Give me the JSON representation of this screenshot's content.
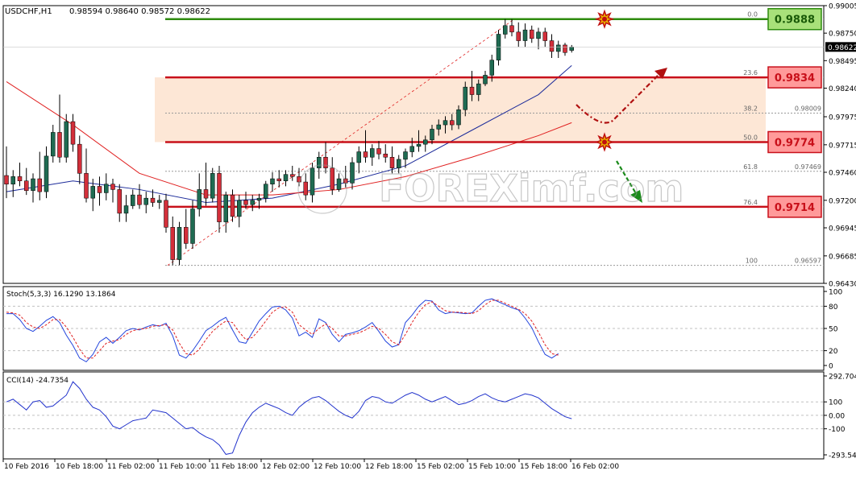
{
  "header": {
    "symbol_label": "USDCHF,H1",
    "ohlc_text": "0.98594 0.98640 0.98572 0.98622"
  },
  "watermark": "FOREXimf.com",
  "colors": {
    "bull": "#1f6b52",
    "bear": "#d32f3a",
    "level_green": "#2e8b0f",
    "level_red": "#c8101a",
    "ma_blue": "#1c2b9a",
    "ma_red": "#e02020",
    "zone": "#fde7d6",
    "stoch_main": "#2244dd",
    "stoch_signal": "#e02020",
    "cci_line": "#2233cc",
    "grid": "#c0c0c0",
    "frame": "#000000"
  },
  "chart_data": [
    {
      "type": "candlestick",
      "symbol": "USDCHF",
      "timeframe": "H1",
      "price_axis": {
        "ticks": [
          "0.99005",
          "0.98750",
          "0.98495",
          "0.98240",
          "0.97975",
          "0.97715",
          "0.97460",
          "0.97200",
          "0.96945",
          "0.96685",
          "0.96430"
        ],
        "ylim": [
          0.9643,
          0.99005
        ],
        "current_price_label": "0.98622"
      },
      "time_axis": {
        "labels": [
          "10 Feb 2016",
          "10 Feb 18:00",
          "11 Feb 02:00",
          "11 Feb 10:00",
          "11 Feb 18:00",
          "12 Feb 02:00",
          "12 Feb 10:00",
          "12 Feb 18:00",
          "15 Feb 02:00",
          "15 Feb 10:00",
          "15 Feb 18:00",
          "16 Feb 02:00"
        ]
      },
      "candles": [
        {
          "o": 0.9743,
          "h": 0.977,
          "l": 0.9722,
          "c": 0.9735
        },
        {
          "o": 0.9735,
          "h": 0.9748,
          "l": 0.9723,
          "c": 0.9742
        },
        {
          "o": 0.9742,
          "h": 0.9755,
          "l": 0.9733,
          "c": 0.9738
        },
        {
          "o": 0.9738,
          "h": 0.975,
          "l": 0.9725,
          "c": 0.9729
        },
        {
          "o": 0.9729,
          "h": 0.9745,
          "l": 0.9718,
          "c": 0.974
        },
        {
          "o": 0.974,
          "h": 0.9765,
          "l": 0.972,
          "c": 0.9728
        },
        {
          "o": 0.9728,
          "h": 0.977,
          "l": 0.9722,
          "c": 0.9761
        },
        {
          "o": 0.9761,
          "h": 0.979,
          "l": 0.9755,
          "c": 0.9783
        },
        {
          "o": 0.9783,
          "h": 0.9818,
          "l": 0.9755,
          "c": 0.976
        },
        {
          "o": 0.976,
          "h": 0.98,
          "l": 0.9755,
          "c": 0.9793
        },
        {
          "o": 0.9793,
          "h": 0.98,
          "l": 0.9765,
          "c": 0.9772
        },
        {
          "o": 0.9772,
          "h": 0.978,
          "l": 0.9735,
          "c": 0.9745
        },
        {
          "o": 0.9745,
          "h": 0.9768,
          "l": 0.9718,
          "c": 0.9722
        },
        {
          "o": 0.9722,
          "h": 0.974,
          "l": 0.971,
          "c": 0.9733
        },
        {
          "o": 0.9733,
          "h": 0.9742,
          "l": 0.9715,
          "c": 0.9727
        },
        {
          "o": 0.9727,
          "h": 0.9745,
          "l": 0.972,
          "c": 0.9735
        },
        {
          "o": 0.9735,
          "h": 0.974,
          "l": 0.9718,
          "c": 0.973
        },
        {
          "o": 0.973,
          "h": 0.9735,
          "l": 0.97,
          "c": 0.9708
        },
        {
          "o": 0.9708,
          "h": 0.9725,
          "l": 0.97,
          "c": 0.9715
        },
        {
          "o": 0.9715,
          "h": 0.973,
          "l": 0.9712,
          "c": 0.9725
        },
        {
          "o": 0.9725,
          "h": 0.9735,
          "l": 0.9712,
          "c": 0.9716
        },
        {
          "o": 0.9716,
          "h": 0.9728,
          "l": 0.9708,
          "c": 0.9722
        },
        {
          "o": 0.9722,
          "h": 0.973,
          "l": 0.9714,
          "c": 0.9718
        },
        {
          "o": 0.9718,
          "h": 0.9725,
          "l": 0.9712,
          "c": 0.972
        },
        {
          "o": 0.972,
          "h": 0.9726,
          "l": 0.969,
          "c": 0.9695
        },
        {
          "o": 0.9695,
          "h": 0.9705,
          "l": 0.966,
          "c": 0.9665
        },
        {
          "o": 0.9665,
          "h": 0.97,
          "l": 0.966,
          "c": 0.9695
        },
        {
          "o": 0.9695,
          "h": 0.9712,
          "l": 0.9675,
          "c": 0.968
        },
        {
          "o": 0.968,
          "h": 0.972,
          "l": 0.9675,
          "c": 0.9712
        },
        {
          "o": 0.9712,
          "h": 0.9745,
          "l": 0.9705,
          "c": 0.973
        },
        {
          "o": 0.973,
          "h": 0.9755,
          "l": 0.9715,
          "c": 0.9722
        },
        {
          "o": 0.9722,
          "h": 0.975,
          "l": 0.9718,
          "c": 0.9745
        },
        {
          "o": 0.9745,
          "h": 0.9752,
          "l": 0.969,
          "c": 0.97
        },
        {
          "o": 0.97,
          "h": 0.9728,
          "l": 0.969,
          "c": 0.9725
        },
        {
          "o": 0.9725,
          "h": 0.973,
          "l": 0.97,
          "c": 0.9705
        },
        {
          "o": 0.9705,
          "h": 0.9725,
          "l": 0.9695,
          "c": 0.972
        },
        {
          "o": 0.972,
          "h": 0.9728,
          "l": 0.9712,
          "c": 0.9716
        },
        {
          "o": 0.9716,
          "h": 0.9725,
          "l": 0.971,
          "c": 0.972
        },
        {
          "o": 0.972,
          "h": 0.9726,
          "l": 0.9712,
          "c": 0.9722
        },
        {
          "o": 0.9722,
          "h": 0.9738,
          "l": 0.9718,
          "c": 0.9735
        },
        {
          "o": 0.9735,
          "h": 0.9746,
          "l": 0.9728,
          "c": 0.974
        },
        {
          "o": 0.974,
          "h": 0.9748,
          "l": 0.9732,
          "c": 0.9738
        },
        {
          "o": 0.9738,
          "h": 0.9748,
          "l": 0.9733,
          "c": 0.9744
        },
        {
          "o": 0.9744,
          "h": 0.9752,
          "l": 0.9738,
          "c": 0.9742
        },
        {
          "o": 0.9742,
          "h": 0.975,
          "l": 0.9733,
          "c": 0.9737
        },
        {
          "o": 0.9737,
          "h": 0.9745,
          "l": 0.972,
          "c": 0.9725
        },
        {
          "o": 0.9725,
          "h": 0.9755,
          "l": 0.9718,
          "c": 0.975
        },
        {
          "o": 0.975,
          "h": 0.9765,
          "l": 0.974,
          "c": 0.976
        },
        {
          "o": 0.976,
          "h": 0.9774,
          "l": 0.9745,
          "c": 0.975
        },
        {
          "o": 0.975,
          "h": 0.976,
          "l": 0.9725,
          "c": 0.973
        },
        {
          "o": 0.973,
          "h": 0.9745,
          "l": 0.9728,
          "c": 0.974
        },
        {
          "o": 0.974,
          "h": 0.9752,
          "l": 0.9732,
          "c": 0.9736
        },
        {
          "o": 0.9736,
          "h": 0.976,
          "l": 0.973,
          "c": 0.9755
        },
        {
          "o": 0.9755,
          "h": 0.977,
          "l": 0.9745,
          "c": 0.9765
        },
        {
          "o": 0.9765,
          "h": 0.9785,
          "l": 0.9755,
          "c": 0.976
        },
        {
          "o": 0.976,
          "h": 0.9772,
          "l": 0.9752,
          "c": 0.9768
        },
        {
          "o": 0.9768,
          "h": 0.9775,
          "l": 0.9758,
          "c": 0.9763
        },
        {
          "o": 0.9763,
          "h": 0.9772,
          "l": 0.9755,
          "c": 0.976
        },
        {
          "o": 0.976,
          "h": 0.977,
          "l": 0.9745,
          "c": 0.975
        },
        {
          "o": 0.975,
          "h": 0.9762,
          "l": 0.9745,
          "c": 0.9758
        },
        {
          "o": 0.9758,
          "h": 0.9768,
          "l": 0.975,
          "c": 0.9765
        },
        {
          "o": 0.9765,
          "h": 0.9778,
          "l": 0.976,
          "c": 0.977
        },
        {
          "o": 0.977,
          "h": 0.9785,
          "l": 0.9765,
          "c": 0.9772
        },
        {
          "o": 0.9772,
          "h": 0.978,
          "l": 0.9765,
          "c": 0.9776
        },
        {
          "o": 0.9776,
          "h": 0.979,
          "l": 0.9772,
          "c": 0.9786
        },
        {
          "o": 0.9786,
          "h": 0.9795,
          "l": 0.978,
          "c": 0.979
        },
        {
          "o": 0.979,
          "h": 0.9798,
          "l": 0.9782,
          "c": 0.9794
        },
        {
          "o": 0.9794,
          "h": 0.98,
          "l": 0.9785,
          "c": 0.979
        },
        {
          "o": 0.979,
          "h": 0.9808,
          "l": 0.9786,
          "c": 0.9804
        },
        {
          "o": 0.9804,
          "h": 0.983,
          "l": 0.9798,
          "c": 0.9825
        },
        {
          "o": 0.9825,
          "h": 0.984,
          "l": 0.9812,
          "c": 0.9818
        },
        {
          "o": 0.9818,
          "h": 0.9832,
          "l": 0.9812,
          "c": 0.9828
        },
        {
          "o": 0.9828,
          "h": 0.984,
          "l": 0.9826,
          "c": 0.9836
        },
        {
          "o": 0.9836,
          "h": 0.9855,
          "l": 0.983,
          "c": 0.985
        },
        {
          "o": 0.985,
          "h": 0.9878,
          "l": 0.9845,
          "c": 0.9874
        },
        {
          "o": 0.9874,
          "h": 0.9888,
          "l": 0.987,
          "c": 0.9882
        },
        {
          "o": 0.9882,
          "h": 0.9888,
          "l": 0.9872,
          "c": 0.9876
        },
        {
          "o": 0.9876,
          "h": 0.9885,
          "l": 0.9862,
          "c": 0.9868
        },
        {
          "o": 0.9868,
          "h": 0.9884,
          "l": 0.9862,
          "c": 0.9878
        },
        {
          "o": 0.9878,
          "h": 0.9882,
          "l": 0.9866,
          "c": 0.987
        },
        {
          "o": 0.987,
          "h": 0.988,
          "l": 0.986,
          "c": 0.9876
        },
        {
          "o": 0.9876,
          "h": 0.988,
          "l": 0.9862,
          "c": 0.9868
        },
        {
          "o": 0.9868,
          "h": 0.9874,
          "l": 0.9852,
          "c": 0.9858
        },
        {
          "o": 0.9858,
          "h": 0.9868,
          "l": 0.9852,
          "c": 0.9864
        },
        {
          "o": 0.9864,
          "h": 0.9866,
          "l": 0.9854,
          "c": 0.9857
        },
        {
          "o": 0.9859,
          "h": 0.9864,
          "l": 0.9857,
          "c": 0.9862
        }
      ],
      "moving_averages": [
        {
          "color_key": "ma_blue",
          "points": [
            [
              0,
              0.9728
            ],
            [
              10,
              0.9738
            ],
            [
              20,
              0.973
            ],
            [
              30,
              0.9718
            ],
            [
              40,
              0.9722
            ],
            [
              50,
              0.9735
            ],
            [
              60,
              0.9752
            ],
            [
              70,
              0.9785
            ],
            [
              80,
              0.9818
            ],
            [
              85,
              0.9845
            ]
          ]
        },
        {
          "color_key": "ma_red",
          "points": [
            [
              0,
              0.983
            ],
            [
              10,
              0.979
            ],
            [
              20,
              0.9745
            ],
            [
              30,
              0.9725
            ],
            [
              40,
              0.9725
            ],
            [
              50,
              0.973
            ],
            [
              60,
              0.9742
            ],
            [
              70,
              0.976
            ],
            [
              80,
              0.978
            ],
            [
              85,
              0.9792
            ]
          ]
        }
      ],
      "fibonacci": {
        "levels": [
          {
            "ratio": "0.0",
            "price": 0.9888
          },
          {
            "ratio": "23.6",
            "price": 0.9834
          },
          {
            "ratio": "38.2",
            "price": 0.98009,
            "price_label": "0.98009"
          },
          {
            "ratio": "50.0",
            "price": 0.9774
          },
          {
            "ratio": "61.8",
            "price": 0.97469,
            "price_label": "0.97469"
          },
          {
            "ratio": "76.4",
            "price": 0.9714
          },
          {
            "ratio": "100",
            "price": 0.96597,
            "price_label": "0.96597"
          }
        ]
      },
      "key_levels": [
        {
          "label": "0.9888",
          "price": 0.9888,
          "color_key": "level_green"
        },
        {
          "label": "0.9834",
          "price": 0.9834,
          "color_key": "level_red"
        },
        {
          "label": "0.9774",
          "price": 0.9774,
          "color_key": "level_red"
        },
        {
          "label": "0.9714",
          "price": 0.9714,
          "color_key": "level_red"
        }
      ],
      "zone": {
        "from": 0.9774,
        "to": 0.9834
      }
    },
    {
      "type": "line",
      "name": "stochastic",
      "label": "Stoch(5,3,3) 16.1290 13.1864",
      "yticks": [
        "100",
        "80",
        "50",
        "20",
        "0"
      ],
      "ylim": [
        0,
        100
      ],
      "main": [
        70,
        70,
        62,
        50,
        46,
        53,
        61,
        66,
        58,
        41,
        27,
        10,
        5,
        15,
        32,
        38,
        30,
        38,
        47,
        50,
        48,
        52,
        55,
        53,
        57,
        40,
        14,
        10,
        20,
        33,
        47,
        53,
        60,
        65,
        48,
        32,
        30,
        45,
        60,
        70,
        79,
        80,
        75,
        64,
        40,
        45,
        38,
        63,
        58,
        42,
        32,
        42,
        44,
        47,
        52,
        58,
        46,
        33,
        25,
        28,
        58,
        68,
        80,
        88,
        87,
        75,
        70,
        72,
        71,
        70,
        71,
        80,
        88,
        90,
        86,
        82,
        78,
        75,
        64,
        51,
        32,
        15,
        10,
        16
      ],
      "signal": [
        72,
        71,
        68,
        58,
        52,
        50,
        55,
        62,
        62,
        52,
        38,
        22,
        10,
        10,
        20,
        30,
        33,
        35,
        42,
        47,
        49,
        50,
        53,
        54,
        55,
        48,
        30,
        16,
        14,
        22,
        35,
        46,
        54,
        60,
        58,
        45,
        35,
        38,
        48,
        60,
        72,
        78,
        79,
        72,
        55,
        48,
        42,
        50,
        56,
        50,
        40,
        40,
        42,
        44,
        48,
        53,
        50,
        42,
        32,
        28,
        42,
        58,
        72,
        82,
        86,
        80,
        74,
        72,
        72,
        71,
        70,
        74,
        82,
        88,
        88,
        84,
        80,
        76,
        70,
        60,
        45,
        28,
        16,
        14
      ]
    },
    {
      "type": "line",
      "name": "cci",
      "label": "CCI(14) -24.7354",
      "yticks": [
        "292.7042",
        "100",
        "0.00",
        "-100",
        "-293.5457"
      ],
      "ylim": [
        -293.5457,
        292.7042
      ],
      "values": [
        100,
        120,
        80,
        40,
        100,
        110,
        60,
        70,
        110,
        150,
        250,
        200,
        120,
        60,
        40,
        -10,
        -80,
        -100,
        -70,
        -40,
        -30,
        -20,
        40,
        30,
        20,
        -20,
        -60,
        -100,
        -90,
        -130,
        -160,
        -180,
        -220,
        -290,
        -280,
        -150,
        -50,
        20,
        60,
        90,
        70,
        50,
        20,
        0,
        60,
        100,
        130,
        140,
        110,
        70,
        30,
        0,
        -20,
        30,
        110,
        140,
        130,
        100,
        90,
        120,
        150,
        170,
        150,
        120,
        100,
        120,
        140,
        110,
        80,
        90,
        110,
        140,
        160,
        130,
        110,
        100,
        120,
        140,
        160,
        150,
        130,
        90,
        50,
        20,
        -10,
        -25
      ]
    }
  ]
}
